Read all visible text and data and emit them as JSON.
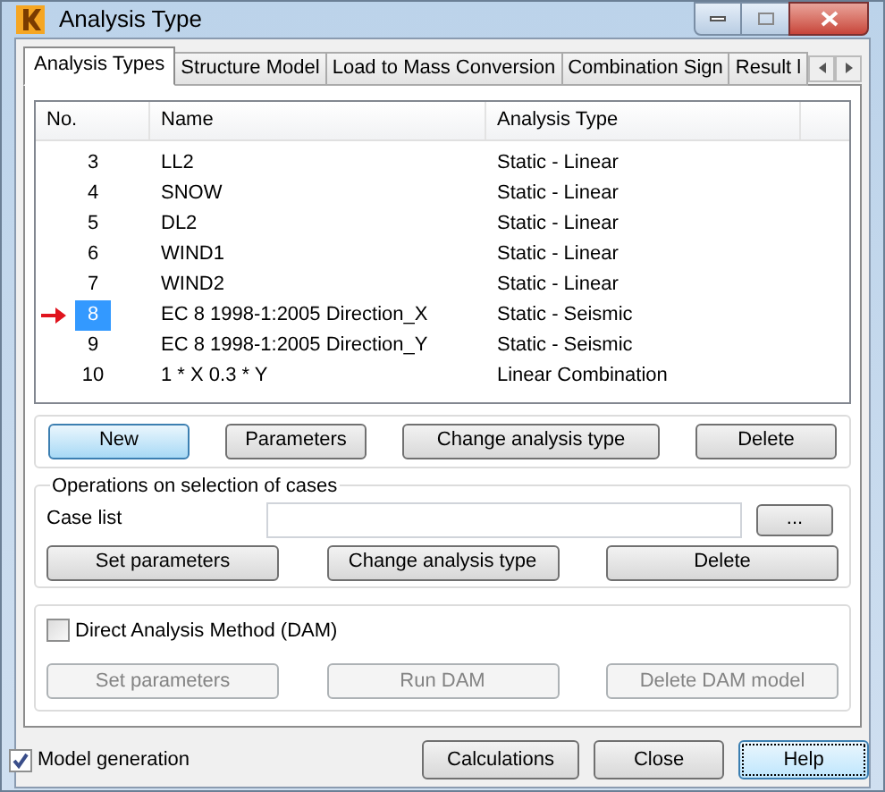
{
  "window": {
    "title": "Analysis Type"
  },
  "tabs": [
    {
      "label": "Analysis Types",
      "selected": true
    },
    {
      "label": "Structure Model",
      "selected": false
    },
    {
      "label": "Load to Mass Conversion",
      "selected": false
    },
    {
      "label": "Combination Sign",
      "selected": false
    },
    {
      "label": "Result l",
      "selected": false
    }
  ],
  "table": {
    "columns": [
      "No.",
      "Name",
      "Analysis Type"
    ],
    "rows": [
      {
        "no": "3",
        "name": "LL2",
        "type": "Static - Linear",
        "selected": false
      },
      {
        "no": "4",
        "name": "SNOW",
        "type": "Static - Linear",
        "selected": false
      },
      {
        "no": "5",
        "name": "DL2",
        "type": "Static - Linear",
        "selected": false
      },
      {
        "no": "6",
        "name": "WIND1",
        "type": "Static - Linear",
        "selected": false
      },
      {
        "no": "7",
        "name": "WIND2",
        "type": "Static - Linear",
        "selected": false
      },
      {
        "no": "8",
        "name": "EC 8 1998-1:2005 Direction_X",
        "type": "Static - Seismic",
        "selected": true
      },
      {
        "no": "9",
        "name": "EC 8 1998-1:2005 Direction_Y",
        "type": "Static - Seismic",
        "selected": false
      },
      {
        "no": "10",
        "name": "1 * X  0.3 * Y",
        "type": "Linear Combination",
        "selected": false
      }
    ]
  },
  "case_buttons": [
    {
      "label": "New",
      "default": true
    },
    {
      "label": "Parameters",
      "default": false
    },
    {
      "label": "Change analysis type",
      "default": false
    },
    {
      "label": "Delete",
      "default": false
    }
  ],
  "operations": {
    "title": "Operations on selection of cases",
    "case_list_label": "Case list",
    "browse_button": "...",
    "buttons": [
      "Set parameters",
      "Change analysis type",
      "Delete"
    ]
  },
  "dam": {
    "label": "Direct Analysis Method (DAM)",
    "checked": false,
    "buttons": [
      {
        "label": "Set parameters",
        "disabled": true
      },
      {
        "label": "Run DAM",
        "disabled": true
      },
      {
        "label": "Delete DAM model",
        "disabled": true
      }
    ]
  },
  "model_generation": {
    "label": "Model generation",
    "checked": true
  },
  "footer_buttons": [
    {
      "label": "Calculations",
      "focused": false
    },
    {
      "label": "Close",
      "focused": false
    },
    {
      "label": "Help",
      "focused": true
    }
  ]
}
